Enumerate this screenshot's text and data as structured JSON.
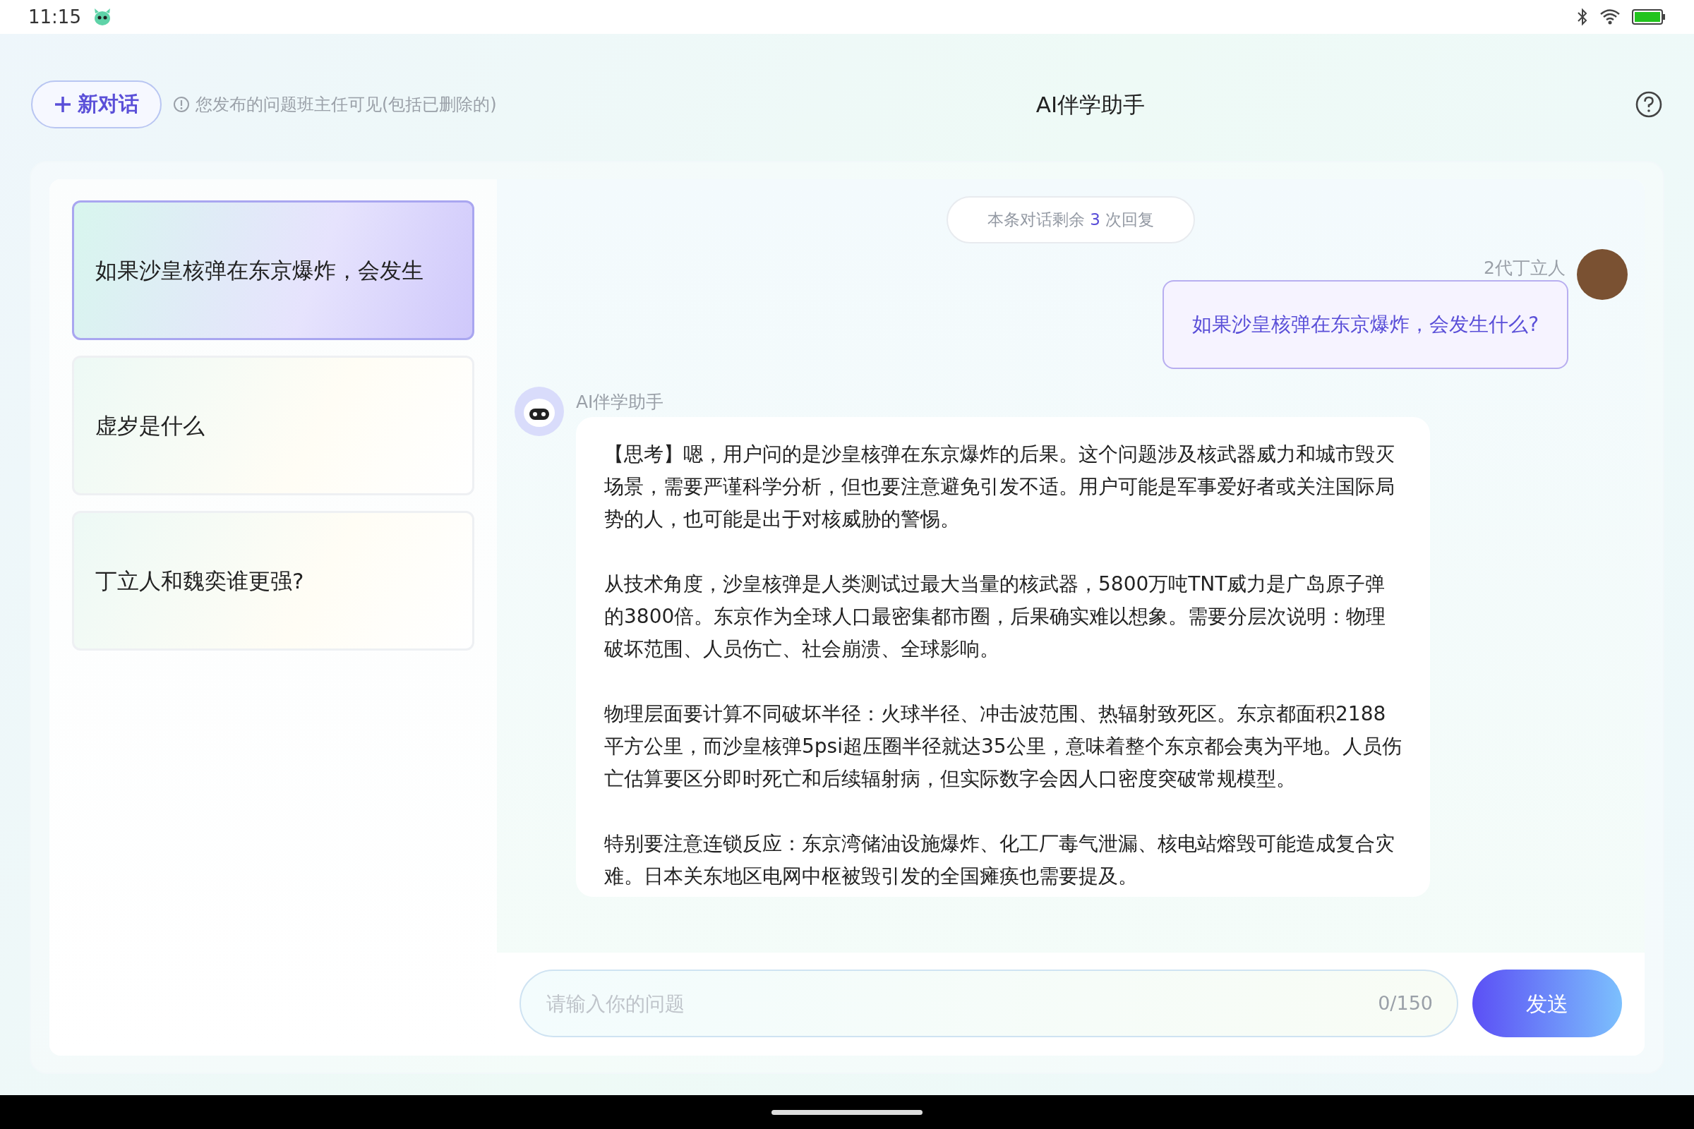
{
  "status_bar": {
    "time": "11:15"
  },
  "header": {
    "new_chat_button": "新对话",
    "notice": "您发布的问题班主任可见(包括已删除的)",
    "title": "AI伴学助手"
  },
  "conversations": [
    {
      "title": "如果沙皇核弹在东京爆炸，会发生",
      "selected": true
    },
    {
      "title": "虚岁是什么",
      "selected": false
    },
    {
      "title": "丁立人和魏奕谁更强?",
      "selected": false
    }
  ],
  "chat": {
    "remaining": {
      "prefix": "本条对话剩余",
      "count": "3",
      "suffix": "次回复"
    },
    "messages": [
      {
        "kind": "user",
        "sender": "2代丁立人",
        "paragraphs": [
          "如果沙皇核弹在东京爆炸，会发生什么?"
        ]
      },
      {
        "kind": "assistant",
        "sender": "AI伴学助手",
        "paragraphs": [
          "【思考】嗯，用户问的是沙皇核弹在东京爆炸的后果。这个问题涉及核武器威力和城市毁灭场景，需要严谨科学分析，但也要注意避免引发不适。用户可能是军事爱好者或关注国际局势的人，也可能是出于对核威胁的警惕。",
          "从技术角度，沙皇核弹是人类测试过最大当量的核武器，5800万吨TNT威力是广岛原子弹的3800倍。东京作为全球人口最密集都市圈，后果确实难以想象。需要分层次说明：物理破坏范围、人员伤亡、社会崩溃、全球影响。",
          "物理层面要计算不同破坏半径：火球半径、冲击波范围、热辐射致死区。东京都面积2188平方公里，而沙皇核弹5psi超压圈半径就达35公里，意味着整个东京都会夷为平地。人员伤亡估算要区分即时死亡和后续辐射病，但实际数字会因人口密度突破常规模型。",
          "特别要注意连锁反应：东京湾储油设施爆炸、化工厂毒气泄漏、核电站熔毁可能造成复合灾难。日本关东地区电网中枢被毁引发的全国瘫痪也需要提及。"
        ]
      }
    ]
  },
  "input": {
    "placeholder": "请输入你的问题",
    "counter": "0/150",
    "send_button": "发送"
  }
}
